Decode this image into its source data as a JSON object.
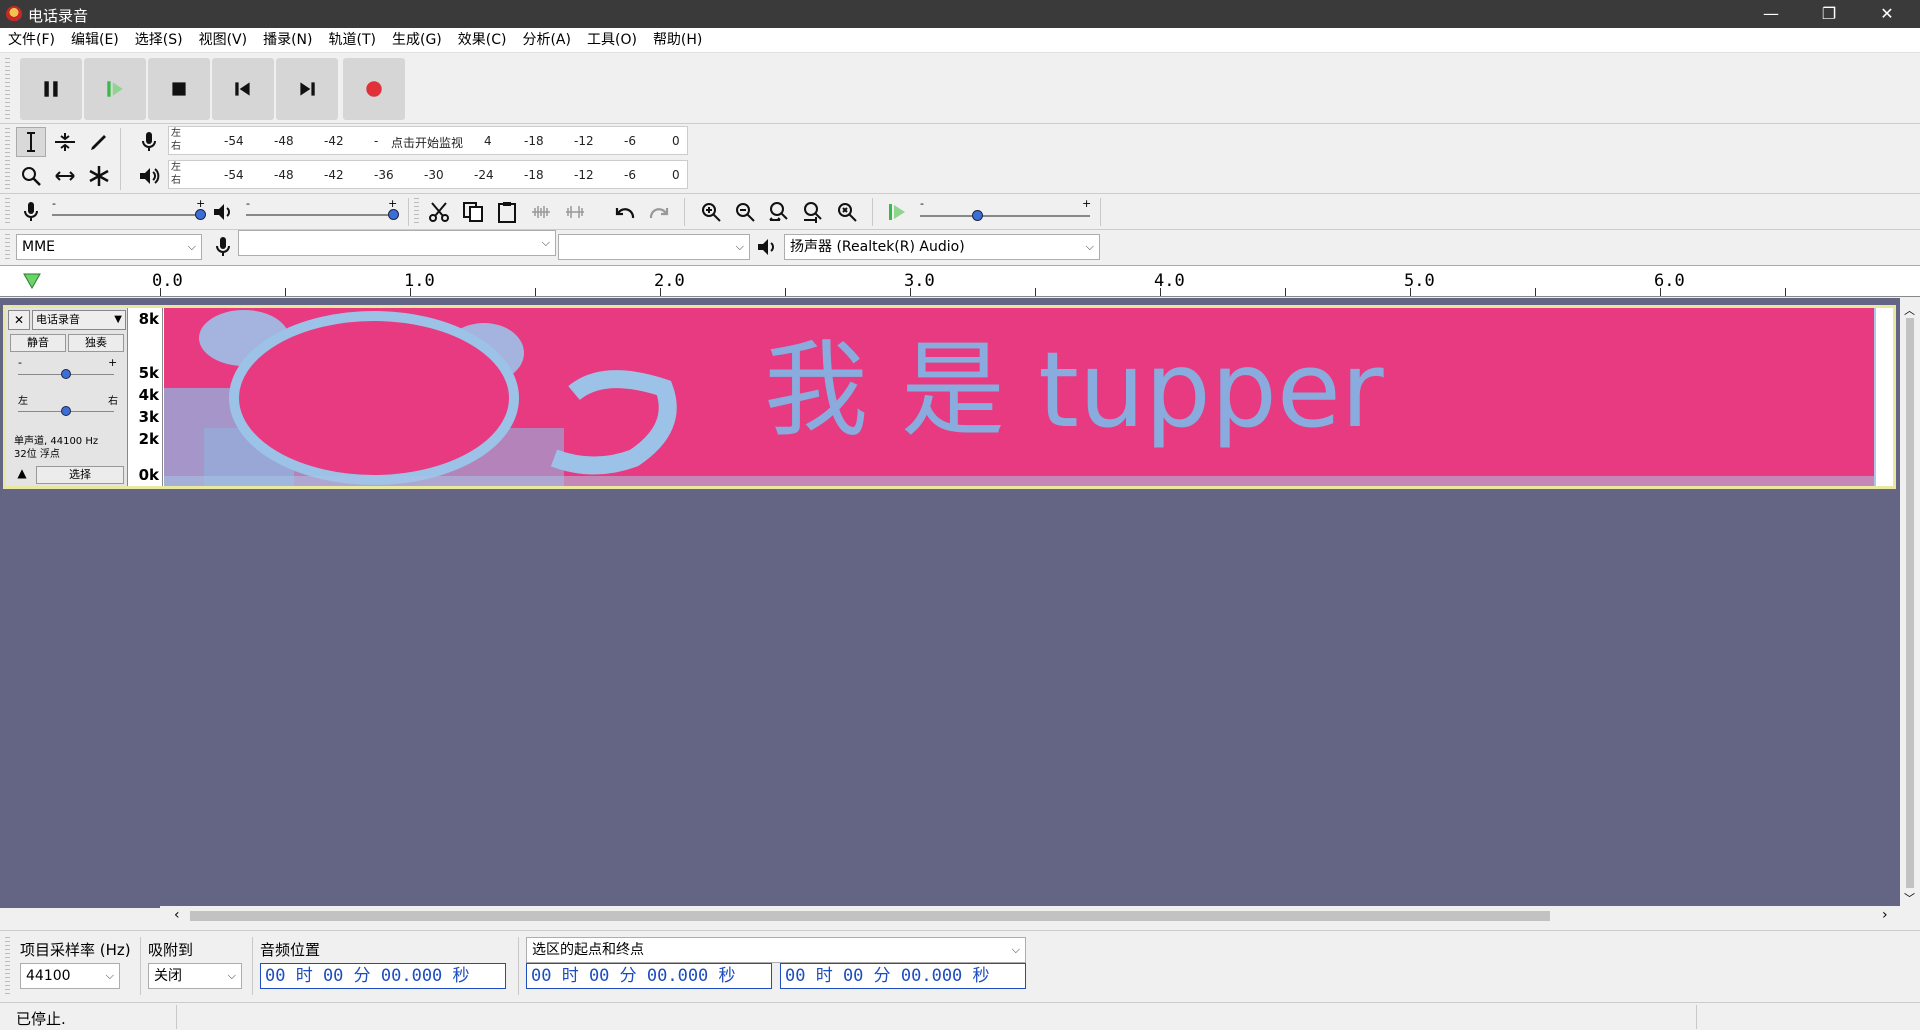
{
  "window": {
    "title": "电话录音",
    "minimize_glyph": "—",
    "maximize_glyph": "❐",
    "close_glyph": "✕"
  },
  "menu": [
    "文件(F)",
    "编辑(E)",
    "选择(S)",
    "视图(V)",
    "播录(N)",
    "轨道(T)",
    "生成(G)",
    "效果(C)",
    "分析(A)",
    "工具(O)",
    "帮助(H)"
  ],
  "transport": {
    "icons": [
      "pause-icon",
      "play-icon",
      "stop-icon",
      "skip-start-icon",
      "skip-end-icon",
      "record-icon"
    ],
    "record_color": "#e0303a",
    "play_color": "#3cb84a"
  },
  "meters": {
    "record": {
      "left_label": "左",
      "right_label": "右",
      "ticks": [
        "-54",
        "-48",
        "-42",
        "-",
        "4",
        "-18",
        "-12",
        "-6",
        "0"
      ],
      "monitor_text": "点击开始监视"
    },
    "playback": {
      "left_label": "左",
      "right_label": "右",
      "ticks": [
        "-54",
        "-48",
        "-42",
        "-36",
        "-30",
        "-24",
        "-18",
        "-12",
        "-6",
        "0"
      ]
    }
  },
  "mixer": {
    "minus": "-",
    "plus": "+"
  },
  "devices": {
    "host": "MME",
    "recording_device": "",
    "recording_channels": "",
    "playback_device": "扬声器 (Realtek(R) Audio)"
  },
  "ruler": {
    "labels": [
      "0.0",
      "1.0",
      "2.0",
      "3.0",
      "4.0",
      "5.0",
      "6.0"
    ]
  },
  "track": {
    "name": "电话录音",
    "close_glyph": "✕",
    "mute_label": "静音",
    "solo_label": "独奏",
    "gain_minus": "-",
    "gain_plus": "+",
    "pan_left": "左",
    "pan_right": "右",
    "info_line1": "单声道, 44100 Hz",
    "info_line2": "32位 浮点",
    "select_label": "选择",
    "freq_labels": [
      "8k",
      "5k",
      "4k",
      "3k",
      "2k",
      "0k"
    ],
    "spectrogram_text": "我 是 tupper",
    "spectrogram_bg": "#e83a80",
    "spectrogram_ink": "#7fb8e8"
  },
  "selection_bar": {
    "rate_label": "项目采样率 (Hz)",
    "rate_value": "44100",
    "snap_label": "吸附到",
    "snap_value": "关闭",
    "position_label": "音频位置",
    "position_value": "00 时 00 分 00.000 秒",
    "range_label": "选区的起点和终点",
    "start_value": "00 时 00 分 00.000 秒",
    "end_value": "00 时 00 分 00.000 秒"
  },
  "status": {
    "text": "已停止."
  }
}
